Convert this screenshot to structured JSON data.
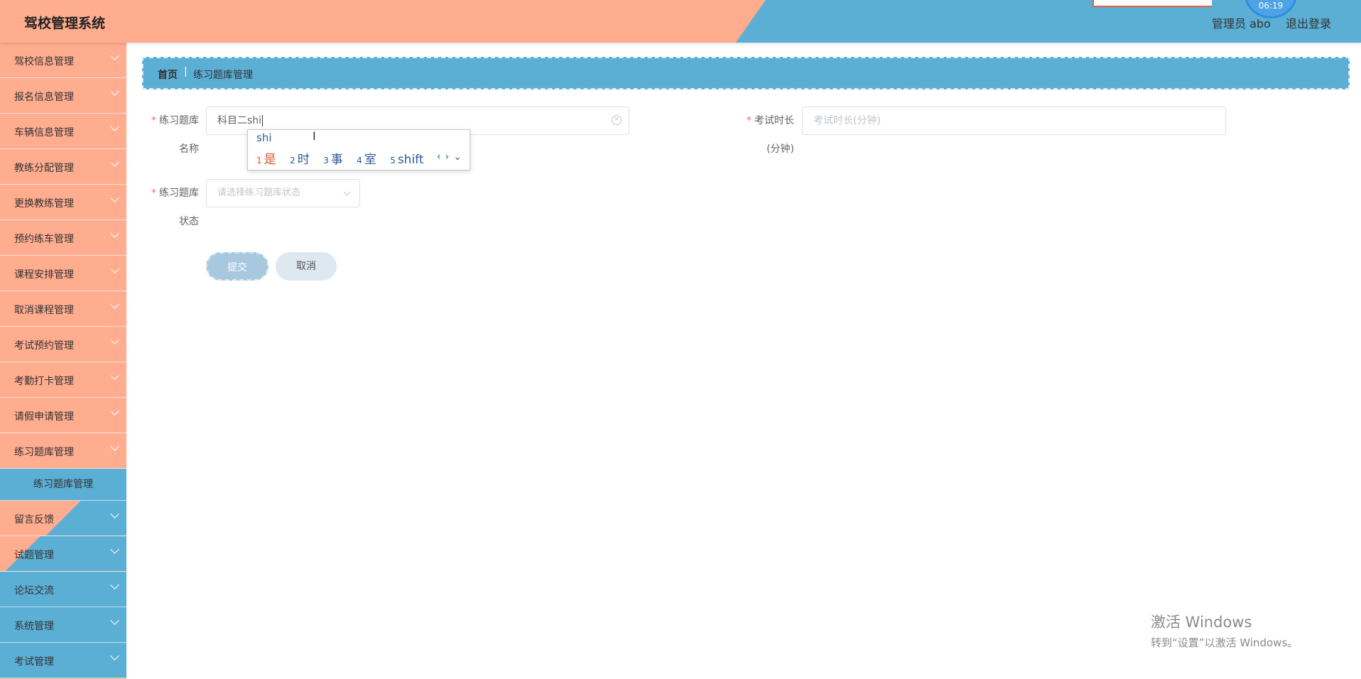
{
  "header": {
    "title": "驾校管理系统",
    "user": "管理员 abo",
    "logout": "退出登录",
    "clock": "06:19",
    "colors": {
      "left": "#ffac8f",
      "right": "#5baed4"
    }
  },
  "sidebar": {
    "items": [
      {
        "label": "驾校信息管理"
      },
      {
        "label": "报名信息管理"
      },
      {
        "label": "车辆信息管理"
      },
      {
        "label": "教练分配管理"
      },
      {
        "label": "更换教练管理"
      },
      {
        "label": "预约练车管理"
      },
      {
        "label": "课程安排管理"
      },
      {
        "label": "取消课程管理"
      },
      {
        "label": "考试预约管理"
      },
      {
        "label": "考勤打卡管理"
      },
      {
        "label": "请假申请管理"
      },
      {
        "label": "练习题库管理"
      }
    ],
    "submenu": "练习题库管理",
    "items_after": [
      {
        "label": "留言反馈"
      },
      {
        "label": "试题管理"
      },
      {
        "label": "论坛交流"
      },
      {
        "label": "系统管理"
      },
      {
        "label": "考试管理"
      }
    ]
  },
  "breadcrumb": {
    "home": "首页",
    "separator": "|",
    "current": "练习题库管理"
  },
  "form": {
    "name_label_1": "练习题库",
    "name_label_2": "名称",
    "name_value": "科目二shi",
    "duration_label_1": "考试时长",
    "duration_label_2": "(分钟)",
    "duration_placeholder": "考试时长(分钟)",
    "status_label_1": "练习题库",
    "status_label_2": "状态",
    "status_placeholder": "请选择练习题库状态",
    "submit": "提交",
    "cancel": "取消"
  },
  "ime": {
    "composition": "shi",
    "candidates": [
      {
        "n": "1",
        "text": "是"
      },
      {
        "n": "2",
        "text": "时"
      },
      {
        "n": "3",
        "text": "事"
      },
      {
        "n": "4",
        "text": "室"
      },
      {
        "n": "5",
        "text": "shift"
      }
    ],
    "nav": "‹›⌄"
  },
  "watermark": {
    "line1": "激活 Windows",
    "line2": "转到“设置”以激活 Windows。"
  }
}
